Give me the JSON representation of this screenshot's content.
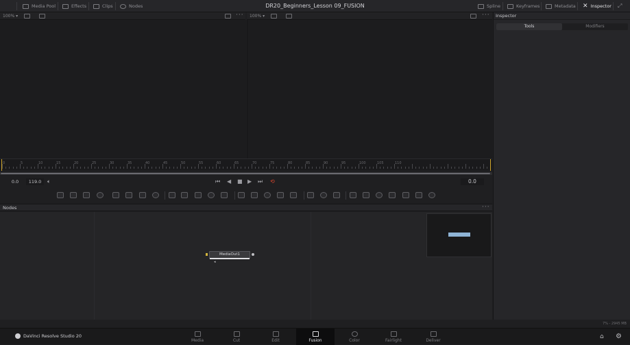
{
  "title": "DR20_Beginners_Lesson 09_FUSION",
  "topbar": {
    "left": [
      {
        "label": "Media Pool",
        "icon": "media-pool-icon"
      },
      {
        "label": "Effects",
        "icon": "effects-icon"
      },
      {
        "label": "Clips",
        "icon": "clips-icon"
      },
      {
        "label": "Nodes",
        "icon": "nodes-icon"
      }
    ],
    "right": [
      {
        "label": "Spline",
        "icon": "spline-icon"
      },
      {
        "label": "Keyframes",
        "icon": "keyframes-icon"
      },
      {
        "label": "Metadata",
        "icon": "metadata-icon"
      },
      {
        "label": "Inspector",
        "icon": "inspector-icon"
      }
    ]
  },
  "viewers": {
    "left_zoom": "100%",
    "right_zoom": "100%"
  },
  "inspector": {
    "title": "Inspector",
    "tabs": [
      "Tools",
      "Modifiers"
    ],
    "active_tab": "Tools"
  },
  "ruler": {
    "labels": [
      "0",
      "5",
      "10",
      "15",
      "20",
      "25",
      "30",
      "35",
      "40",
      "45",
      "50",
      "55",
      "60",
      "65",
      "70",
      "75",
      "80",
      "85",
      "90",
      "95",
      "100",
      "105",
      "110"
    ]
  },
  "transport": {
    "start": "0.0",
    "end": "119.0",
    "current": "0.0",
    "loop_color": "#e0482f"
  },
  "nodes": {
    "title": "Nodes",
    "node": {
      "label": "MediaOut1"
    }
  },
  "status": {
    "memory": "7% - 2945 MB"
  },
  "brand": {
    "name": "DaVinci Resolve Studio 20"
  },
  "pages": [
    {
      "label": "Media"
    },
    {
      "label": "Cut"
    },
    {
      "label": "Edit"
    },
    {
      "label": "Fusion"
    },
    {
      "label": "Color"
    },
    {
      "label": "Fairlight"
    },
    {
      "label": "Deliver"
    }
  ],
  "active_page": "Fusion",
  "colors": {
    "accent": "#d2a72a",
    "node_highlight": "#8fb4d6"
  }
}
